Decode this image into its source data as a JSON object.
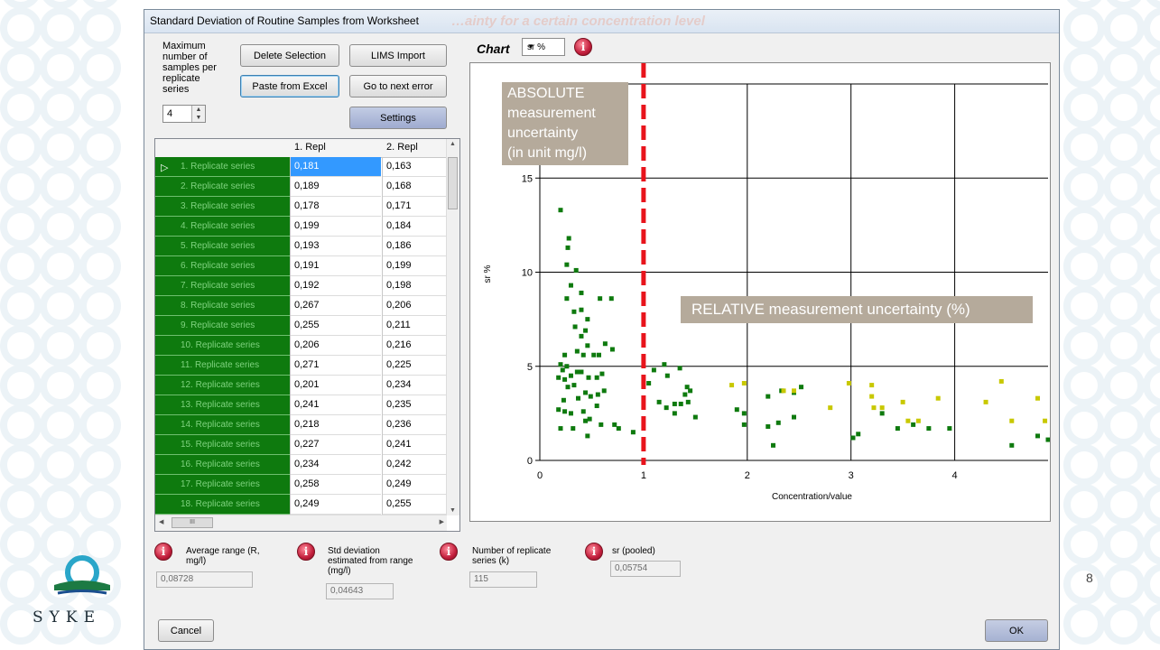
{
  "window": {
    "title": "Standard Deviation of Routine Samples from Worksheet",
    "background_text": "…ainty for a certain concentration level"
  },
  "controls": {
    "max_samples_label": "Maximum number of samples per replicate series",
    "spinner_value": "4",
    "delete_selection": "Delete Selection",
    "lims_import": "LIMS Import",
    "paste_from_excel": "Paste from Excel",
    "go_to_next_error": "Go to next error",
    "settings": "Settings"
  },
  "grid": {
    "columns": [
      "1. Repl",
      "2. Repl"
    ],
    "rows": [
      {
        "label": "1. Replicate series",
        "r1": "0,181",
        "r2": "0,163"
      },
      {
        "label": "2. Replicate series",
        "r1": "0,189",
        "r2": "0,168"
      },
      {
        "label": "3. Replicate series",
        "r1": "0,178",
        "r2": "0,171"
      },
      {
        "label": "4. Replicate series",
        "r1": "0,199",
        "r2": "0,184"
      },
      {
        "label": "5. Replicate series",
        "r1": "0,193",
        "r2": "0,186"
      },
      {
        "label": "6. Replicate series",
        "r1": "0,191",
        "r2": "0,199"
      },
      {
        "label": "7. Replicate series",
        "r1": "0,192",
        "r2": "0,198"
      },
      {
        "label": "8. Replicate series",
        "r1": "0,267",
        "r2": "0,206"
      },
      {
        "label": "9. Replicate series",
        "r1": "0,255",
        "r2": "0,211"
      },
      {
        "label": "10. Replicate series",
        "r1": "0,206",
        "r2": "0,216"
      },
      {
        "label": "11. Replicate series",
        "r1": "0,271",
        "r2": "0,225"
      },
      {
        "label": "12. Replicate series",
        "r1": "0,201",
        "r2": "0,234"
      },
      {
        "label": "13. Replicate series",
        "r1": "0,241",
        "r2": "0,235"
      },
      {
        "label": "14. Replicate series",
        "r1": "0,218",
        "r2": "0,236"
      },
      {
        "label": "15. Replicate series",
        "r1": "0,227",
        "r2": "0,241"
      },
      {
        "label": "16. Replicate series",
        "r1": "0,234",
        "r2": "0,242"
      },
      {
        "label": "17. Replicate series",
        "r1": "0,258",
        "r2": "0,249"
      },
      {
        "label": "18. Replicate series",
        "r1": "0,249",
        "r2": "0,255"
      }
    ],
    "hscroll_glyph": "III"
  },
  "chart_header": {
    "title": "Chart",
    "select_value": "sr %"
  },
  "chart_data": {
    "type": "scatter",
    "xlabel": "Concentration/value",
    "ylabel": "sr %",
    "xlim": [
      0,
      4.9
    ],
    "ylim": [
      0,
      20
    ],
    "xticks": [
      "0",
      "1",
      "2",
      "3",
      "4"
    ],
    "yticks": [
      "0",
      "5",
      "10",
      "15"
    ],
    "vline_x": 1,
    "series": [
      {
        "color": "#0e7a0e",
        "points": [
          [
            0.2,
            13.3
          ],
          [
            0.28,
            11.8
          ],
          [
            0.27,
            11.3
          ],
          [
            0.26,
            10.4
          ],
          [
            0.35,
            10.1
          ],
          [
            0.3,
            9.3
          ],
          [
            0.26,
            8.6
          ],
          [
            0.4,
            8.9
          ],
          [
            0.58,
            8.6
          ],
          [
            0.69,
            8.6
          ],
          [
            0.4,
            8.0
          ],
          [
            0.33,
            7.9
          ],
          [
            0.34,
            7.1
          ],
          [
            0.46,
            7.5
          ],
          [
            0.44,
            6.9
          ],
          [
            0.4,
            6.6
          ],
          [
            0.46,
            6.1
          ],
          [
            0.63,
            6.2
          ],
          [
            0.7,
            5.9
          ],
          [
            0.36,
            5.8
          ],
          [
            0.42,
            5.6
          ],
          [
            0.24,
            5.6
          ],
          [
            0.52,
            5.6
          ],
          [
            0.57,
            5.6
          ],
          [
            0.2,
            5.1
          ],
          [
            0.26,
            5.0
          ],
          [
            0.3,
            4.5
          ],
          [
            0.22,
            4.8
          ],
          [
            0.36,
            4.7
          ],
          [
            0.4,
            4.7
          ],
          [
            0.18,
            4.4
          ],
          [
            0.24,
            4.3
          ],
          [
            0.27,
            3.9
          ],
          [
            0.33,
            4.0
          ],
          [
            0.47,
            4.4
          ],
          [
            0.55,
            4.4
          ],
          [
            0.6,
            4.6
          ],
          [
            0.62,
            3.7
          ],
          [
            0.56,
            3.5
          ],
          [
            0.49,
            3.4
          ],
          [
            0.44,
            3.6
          ],
          [
            0.37,
            3.3
          ],
          [
            0.23,
            3.2
          ],
          [
            0.18,
            2.7
          ],
          [
            0.24,
            2.6
          ],
          [
            0.3,
            2.5
          ],
          [
            0.42,
            2.6
          ],
          [
            0.48,
            2.2
          ],
          [
            0.55,
            2.9
          ],
          [
            0.44,
            2.1
          ],
          [
            0.59,
            1.9
          ],
          [
            0.72,
            1.9
          ],
          [
            0.2,
            1.7
          ],
          [
            0.32,
            1.7
          ],
          [
            0.46,
            1.3
          ],
          [
            0.76,
            1.7
          ],
          [
            0.9,
            1.5
          ],
          [
            1.2,
            5.1
          ],
          [
            1.35,
            4.9
          ],
          [
            1.23,
            4.5
          ],
          [
            1.05,
            4.1
          ],
          [
            1.1,
            4.8
          ],
          [
            1.42,
            3.9
          ],
          [
            1.45,
            3.7
          ],
          [
            1.4,
            3.5
          ],
          [
            1.15,
            3.1
          ],
          [
            1.3,
            3.0
          ],
          [
            1.36,
            3.0
          ],
          [
            1.22,
            2.8
          ],
          [
            1.3,
            2.5
          ],
          [
            1.43,
            3.1
          ],
          [
            1.5,
            2.3
          ],
          [
            1.9,
            2.7
          ],
          [
            1.97,
            2.5
          ],
          [
            1.97,
            1.9
          ],
          [
            2.2,
            3.4
          ],
          [
            2.33,
            3.7
          ],
          [
            2.45,
            3.6
          ],
          [
            2.52,
            3.9
          ],
          [
            2.2,
            1.8
          ],
          [
            2.3,
            2.0
          ],
          [
            2.45,
            2.3
          ],
          [
            2.25,
            0.8
          ],
          [
            3.02,
            1.2
          ],
          [
            3.07,
            1.4
          ],
          [
            3.3,
            2.5
          ],
          [
            3.45,
            1.7
          ],
          [
            3.6,
            1.9
          ],
          [
            3.75,
            1.7
          ],
          [
            3.95,
            1.7
          ],
          [
            4.55,
            0.8
          ],
          [
            4.8,
            1.3
          ],
          [
            4.9,
            1.1
          ]
        ]
      },
      {
        "color": "#c8c800",
        "points": [
          [
            1.85,
            4.0
          ],
          [
            1.97,
            4.1
          ],
          [
            2.35,
            3.7
          ],
          [
            2.45,
            3.7
          ],
          [
            2.8,
            2.8
          ],
          [
            2.98,
            4.1
          ],
          [
            3.2,
            4.0
          ],
          [
            3.2,
            3.4
          ],
          [
            3.22,
            2.8
          ],
          [
            3.3,
            2.8
          ],
          [
            3.5,
            3.1
          ],
          [
            3.55,
            2.1
          ],
          [
            3.65,
            2.1
          ],
          [
            3.84,
            3.3
          ],
          [
            4.3,
            3.1
          ],
          [
            4.45,
            4.2
          ],
          [
            4.55,
            2.1
          ],
          [
            4.8,
            3.3
          ],
          [
            4.87,
            2.1
          ]
        ]
      }
    ]
  },
  "annotations": {
    "absolute": [
      "ABSOLUTE",
      "measurement",
      "uncertainty",
      "(in unit mg/l)"
    ],
    "relative": "RELATIVE measurement uncertainty (%)"
  },
  "stats": {
    "avg_range_label": "Average range (R, mg/l)",
    "avg_range_value": "0,08728",
    "std_label": "Std deviation estimated from range (mg/l)",
    "std_value": "0,04643",
    "k_label": "Number of replicate series (k)",
    "k_value": "115",
    "sr_label": "sr (pooled)",
    "sr_value": "0,05754"
  },
  "footer": {
    "cancel": "Cancel",
    "ok": "OK"
  },
  "slide": {
    "page_number": "8",
    "logo_text": "SYKE"
  }
}
